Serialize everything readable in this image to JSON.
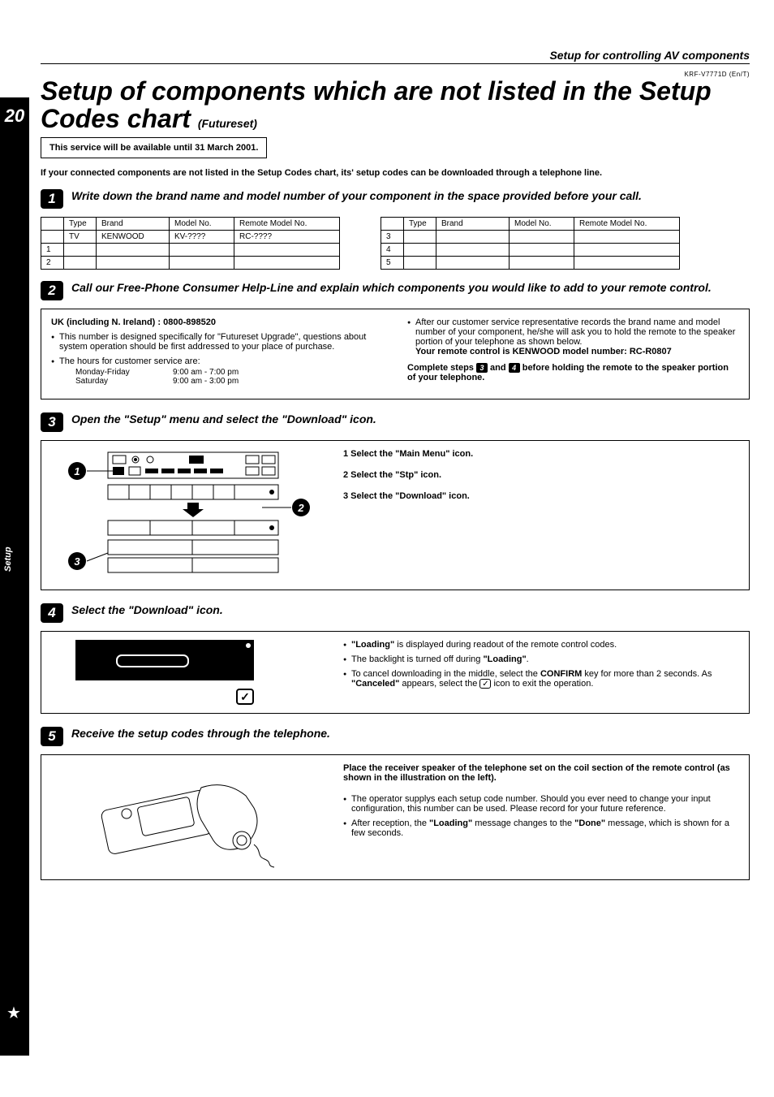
{
  "header": {
    "section_title": "Setup for controlling AV components",
    "model_code": "KRF-V7771D (En/T)"
  },
  "sidebar": {
    "page_number": "20",
    "vertical_label": "Setup"
  },
  "title": {
    "main": "Setup of components which are not listed in the Setup Codes chart",
    "suffix": "(Futureset)"
  },
  "service_notice": "This service will be available until 31 March 2001.",
  "intro": "If your connected components are not listed in the Setup Codes chart, its' setup codes can be downloaded through a telephone line.",
  "steps": {
    "s1": {
      "num": "1",
      "title": "Write down the brand name and model number of your component in the space provided before your call.",
      "table_headers": {
        "type": "Type",
        "brand": "Brand",
        "model": "Model No.",
        "remote": "Remote Model No."
      },
      "table1": [
        {
          "idx": "",
          "type": "TV",
          "brand": "KENWOOD",
          "model": "KV-????",
          "remote": "RC-????"
        },
        {
          "idx": "1",
          "type": "",
          "brand": "",
          "model": "",
          "remote": ""
        },
        {
          "idx": "2",
          "type": "",
          "brand": "",
          "model": "",
          "remote": ""
        }
      ],
      "table2": [
        {
          "idx": "3",
          "type": "",
          "brand": "",
          "model": "",
          "remote": ""
        },
        {
          "idx": "4",
          "type": "",
          "brand": "",
          "model": "",
          "remote": ""
        },
        {
          "idx": "5",
          "type": "",
          "brand": "",
          "model": "",
          "remote": ""
        }
      ]
    },
    "s2": {
      "num": "2",
      "title": "Call our Free-Phone Consumer Help-Line and explain which components you would like to add to your remote control.",
      "uk_line": "UK (including N. Ireland) : 0800-898520",
      "uk_note": "This number is designed specifically for \"Futureset Upgrade\", questions about system operation should be first addressed to your place of purchase.",
      "hours_label": "The hours for customer service are:",
      "hours": [
        {
          "day": "Monday-Friday",
          "time": "9:00 am - 7:00 pm"
        },
        {
          "day": "Saturday",
          "time": "9:00 am - 3:00 pm"
        }
      ],
      "cs_note": "After our customer service representative records the brand name and model number of your component, he/she will ask you to hold the remote to the speaker portion of your telephone as shown below.",
      "remote_model_line": "Your remote control is KENWOOD model number: RC-R0807",
      "complete_prefix": "Complete steps ",
      "complete_mid": " and ",
      "complete_suffix": " before holding the remote to the speaker portion of your telephone.",
      "badge3": "3",
      "badge4": "4"
    },
    "s3": {
      "num": "3",
      "title": "Open the \"Setup\" menu and select the \"Download\" icon.",
      "a1": "1",
      "a2": "2",
      "a3": "3",
      "note1_pref": "1",
      "note1": "Select the \"Main Menu\" icon.",
      "note2_pref": "2",
      "note2": "Select the \"Stp\" icon.",
      "note3_pref": "3",
      "note3": "Select the \"Download\" icon."
    },
    "s4": {
      "num": "4",
      "title": "Select the \"Download\" icon.",
      "bullets": {
        "b1a": "\"Loading\"",
        "b1b": " is displayed during readout of the remote control codes.",
        "b2a": "The backlight is turned off during ",
        "b2b": "\"Loading\"",
        "b2c": ".",
        "b3a": "To cancel downloading in the middle, select the ",
        "b3b": "CONFIRM",
        "b3c": " key for more than 2 seconds. As ",
        "b3d": "\"Canceled\"",
        "b3e": " appears, select the ",
        "b3f": " icon to exit the operation."
      }
    },
    "s5": {
      "num": "5",
      "title": "Receive the setup codes through the telephone.",
      "place_text": "Place the receiver speaker of the telephone set on the coil section of the remote control (as shown in the illustration on the left).",
      "bullets": {
        "b1": "The operator supplys each setup code number. Should you ever need to change your input configuration, this number can be used. Please record for your future reference.",
        "b2a": "After reception, the ",
        "b2b": "\"Loading\"",
        "b2c": " message changes to the ",
        "b2d": "\"Done\"",
        "b2e": " message, which is shown for a few seconds."
      }
    }
  }
}
